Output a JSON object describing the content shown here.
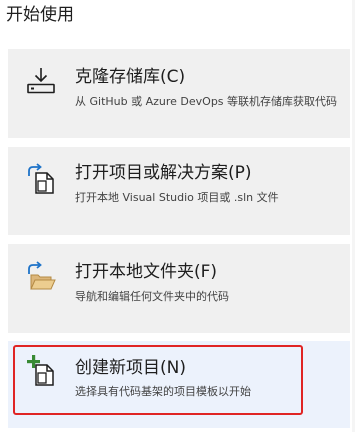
{
  "section": {
    "title": "开始使用"
  },
  "cards": [
    {
      "title": "克隆存储库(C)",
      "desc": "从 GitHub 或 Azure DevOps 等联机存储库获取代码",
      "icon": "clone-repository-icon"
    },
    {
      "title": "打开项目或解决方案(P)",
      "desc": "打开本地 Visual Studio 项目或 .sln 文件",
      "icon": "open-project-icon"
    },
    {
      "title": "打开本地文件夹(F)",
      "desc": "导航和编辑任何文件夹中的代码",
      "icon": "open-folder-icon"
    },
    {
      "title": "创建新项目(N)",
      "desc": "选择具有代码基架的项目模板以开始",
      "icon": "new-project-icon"
    }
  ],
  "colors": {
    "card_background": "#f0f0f0",
    "selected_background": "#ecf2fc",
    "highlight_border": "#e02424",
    "icon_dark": "#1e1e1e",
    "icon_blue": "#1e73c8",
    "icon_green": "#388a34",
    "folder_yellow": "#dcb67a"
  }
}
